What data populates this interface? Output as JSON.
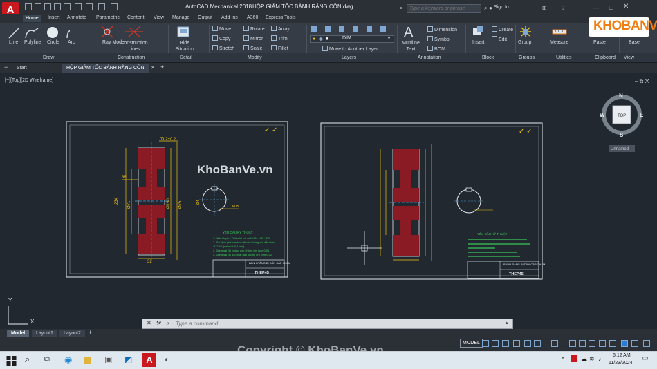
{
  "title_bar": {
    "app_letter": "A",
    "app_name": "AutoCAD Mechanical 2018",
    "file_name": "HỘP GIẢM TỐC BÁNH RĂNG CÔN.dwg",
    "search_placeholder": "Type a keyword or phrase",
    "signin_label": "Sign In"
  },
  "ribbon_tabs": [
    "Home",
    "Insert",
    "Annotate",
    "Parametric",
    "Content",
    "View",
    "Manage",
    "Output",
    "Add-ins",
    "A360",
    "Express Tools"
  ],
  "ribbon": {
    "draw": {
      "line": "Line",
      "polyline": "Polyline",
      "circle": "Circle",
      "arc": "Arc"
    },
    "construction": {
      "ray_mode": "Ray Mode",
      "construction_lines": "Construction Lines"
    },
    "detail": {
      "hide_situation": "Hide Situation"
    },
    "modify": {
      "move": "Move",
      "rotate": "Rotate",
      "array": "Array",
      "copy": "Copy",
      "mirror": "Mirror",
      "trim": "Trim",
      "stretch": "Stretch",
      "scale": "Scale",
      "fillet": "Fillet"
    },
    "layers": {
      "current_layer": "DIM",
      "move_to_layer": "Move to Another Layer"
    },
    "annotation": {
      "multiline_text": "Multiline Text",
      "dimension": "Dimension",
      "symbol": "Symbol",
      "bom": "BOM"
    },
    "block": {
      "insert": "Insert",
      "create": "Create",
      "edit": "Edit"
    },
    "groups": {
      "group": "Group"
    },
    "utilities": {
      "measure": "Measure"
    },
    "clipboard": {
      "paste": "Paste"
    },
    "view": {
      "base": "Base"
    }
  },
  "panel_labels": [
    "Draw",
    "Construction",
    "Detail",
    "Modify",
    "Layers",
    "Annotation",
    "Block",
    "Groups",
    "Utilities",
    "Clipboard",
    "View"
  ],
  "doc_tabs": {
    "start": "Start",
    "active": "HỘP GIẢM TỐC BÁNH RĂNG CÔN",
    "new": "+"
  },
  "viewport": {
    "label": "[−][Top][2D Wireframe]",
    "viewcube": {
      "top": "TOP",
      "north": "N",
      "south": "S",
      "east": "E",
      "west": "W",
      "ucs": "Unnamed"
    },
    "ucs_x": "X",
    "ucs_y": "Y"
  },
  "drawing": {
    "left": {
      "dims": {
        "a": "234",
        "b": "Ø71",
        "c": "Ø190",
        "d": "Ø75",
        "e": "Ø4",
        "f": "38",
        "g": "32",
        "h": "TL2+0,2"
      },
      "notes_title": "YÊU CẦU KỸ THUẬT",
      "notes": [
        "1. Nhiệt luyện: Thấm tôi bề mặt HRc 170 ÷ 220",
        "2. Sai lệch giới hạn kích thước không chỉ dẫn theo",
        "   ±IT14/2 (sai số ± 0,5 mm)",
        "3. Dung sai độ vuông góc không lớn hơn 0,01",
        "4. Dung sai độ đảo mặt đầu không lớn hơn 0,02"
      ],
      "titleblock": {
        "part_name": "BÁNH RĂNG BỊ DẪN CẤP CHẬM",
        "material": "THEP45"
      }
    },
    "right": {
      "notes_title": "YÊU CẦU KỸ THUẬT",
      "titleblock": {
        "part_name": "BÁNH RĂNG BỊ DẪN CẤP CHẬM",
        "material": "THEP45"
      }
    }
  },
  "watermark": "KhoBanVe.vn",
  "logo": "KHOBANVE",
  "command_line": {
    "placeholder": "Type a command"
  },
  "layout_tabs": [
    "Model",
    "Layout1",
    "Layout2"
  ],
  "layout_add": "+",
  "status_bar": {
    "mode": "MODEL"
  },
  "copyright": "Copyright © KhoBanVe.vn",
  "taskbar": {
    "time": "6:12 AM",
    "date": "11/23/2024"
  }
}
